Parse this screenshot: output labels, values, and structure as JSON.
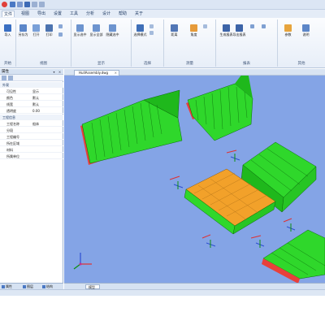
{
  "menu": {
    "items": [
      "文件",
      "视图",
      "导出",
      "设置",
      "工具",
      "分析",
      "设计",
      "帮助",
      "关于"
    ]
  },
  "ribbon": {
    "groups": [
      {
        "label": "开始",
        "buttons": [
          "导入",
          "另存为",
          "打开",
          "打印"
        ]
      },
      {
        "label": "视图",
        "buttons": [
          "平移",
          "缩放"
        ]
      },
      {
        "label": "显示",
        "buttons": [
          "显示选中",
          "显示全部",
          "隐藏选中"
        ]
      },
      {
        "label": "选择",
        "buttons": [
          "选择模式"
        ]
      },
      {
        "label": "测量",
        "buttons": [
          "距离",
          "角度"
        ]
      },
      {
        "label": "报表",
        "buttons": [
          "生成报表",
          "导出报表"
        ]
      },
      {
        "label": "其他",
        "buttons": [
          "参数",
          "说明"
        ]
      }
    ]
  },
  "left_panel": {
    "title": "属性",
    "rows": [
      {
        "type": "cat",
        "k": "外观"
      },
      {
        "type": "row",
        "k": "可见性",
        "v": "显示"
      },
      {
        "type": "row",
        "k": "颜色",
        "v": "默认"
      },
      {
        "type": "row",
        "k": "线宽",
        "v": "默认"
      },
      {
        "type": "row",
        "k": "透明度",
        "v": "0.00"
      },
      {
        "type": "cat",
        "k": "工程信息"
      },
      {
        "type": "row",
        "k": "工程名称",
        "v": "船体"
      },
      {
        "type": "row",
        "k": "分段",
        "v": ""
      },
      {
        "type": "row",
        "k": "工程编号",
        "v": ""
      },
      {
        "type": "row",
        "k": "所在区域",
        "v": ""
      },
      {
        "type": "row",
        "k": "材料",
        "v": ""
      },
      {
        "type": "row",
        "k": "所属单位",
        "v": ""
      }
    ],
    "tabs": [
      "属性",
      "图层",
      "结构"
    ]
  },
  "document": {
    "tab_title": "HullAssembly.dwg"
  },
  "view": {
    "bottom_tab": "模型"
  },
  "colors": {
    "viewport_bg": "#84a4e6",
    "block_green": "#2fd72b",
    "block_orange": "#f2a12a",
    "block_red": "#e8403b",
    "ribbon_bg": "#e7eef8"
  }
}
